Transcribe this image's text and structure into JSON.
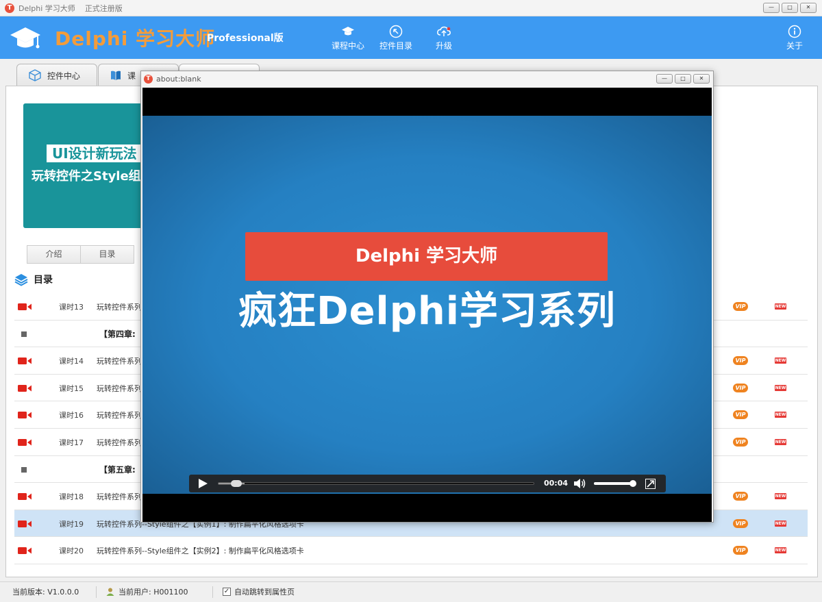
{
  "window": {
    "title": "Delphi 学习大师",
    "edition_note": "正式注册版",
    "icon_letter": "T",
    "buttons": [
      "—",
      "□",
      "✕"
    ]
  },
  "header": {
    "brand": "Delphi 学习大师",
    "edition": "Professional版",
    "nav": [
      {
        "label": "课程中心",
        "icon": "graduation-cap-icon"
      },
      {
        "label": "控件目录",
        "icon": "arrow-upleft-circle-icon"
      },
      {
        "label": "升级",
        "icon": "cloud-upload-icon"
      }
    ],
    "about_label": "关于",
    "colors": {
      "header_bg": "#3d9af2",
      "brand": "#f39c3b"
    }
  },
  "tabs": [
    {
      "label": "控件中心",
      "icon": "cube-icon"
    },
    {
      "label": "课",
      "icon": "book-icon"
    },
    {
      "label": "",
      "icon": "page-icon"
    }
  ],
  "banner": {
    "line1": "UI设计新玩法",
    "line2": "玩转控件之Style组件"
  },
  "subtabs": [
    "介绍",
    "目录"
  ],
  "toc_title": "目录",
  "rows": [
    {
      "type": "lesson",
      "lesson": "课时13",
      "title": "玩转控件系列",
      "vip": "VIP",
      "new": "NEW"
    },
    {
      "type": "chapter",
      "title": "【第四章:"
    },
    {
      "type": "lesson",
      "lesson": "课时14",
      "title": "玩转控件系列",
      "vip": "VIP",
      "new": "NEW"
    },
    {
      "type": "lesson",
      "lesson": "课时15",
      "title": "玩转控件系列",
      "vip": "VIP",
      "new": "NEW"
    },
    {
      "type": "lesson",
      "lesson": "课时16",
      "title": "玩转控件系列",
      "vip": "VIP",
      "new": "NEW"
    },
    {
      "type": "lesson",
      "lesson": "课时17",
      "title": "玩转控件系列",
      "vip": "VIP",
      "new": "NEW"
    },
    {
      "type": "chapter",
      "title": "【第五章:"
    },
    {
      "type": "lesson",
      "lesson": "课时18",
      "title": "玩转控件系列",
      "vip": "VIP",
      "new": "NEW"
    },
    {
      "type": "lesson",
      "lesson": "课时19",
      "title": "玩转控件系列--Style组件之【实例1】: 制作扁平化风格选项卡",
      "vip": "VIP",
      "new": "NEW",
      "selected": true
    },
    {
      "type": "lesson",
      "lesson": "课时20",
      "title": "玩转控件系列--Style组件之【实例2】: 制作扁平化风格选项卡",
      "vip": "VIP",
      "new": "NEW"
    }
  ],
  "statusbar": {
    "version": "当前版本: V1.0.0.0",
    "user": "当前用户: H001100",
    "auto_jump_label": "自动跳转到属性页",
    "auto_jump_checked": "✓"
  },
  "popup": {
    "title": "about:blank",
    "video_banner": "Delphi 学习大师",
    "video_title": "疯狂Delphi学习系列",
    "time": "00:04",
    "progress": 0.04,
    "volume": 0.95
  }
}
